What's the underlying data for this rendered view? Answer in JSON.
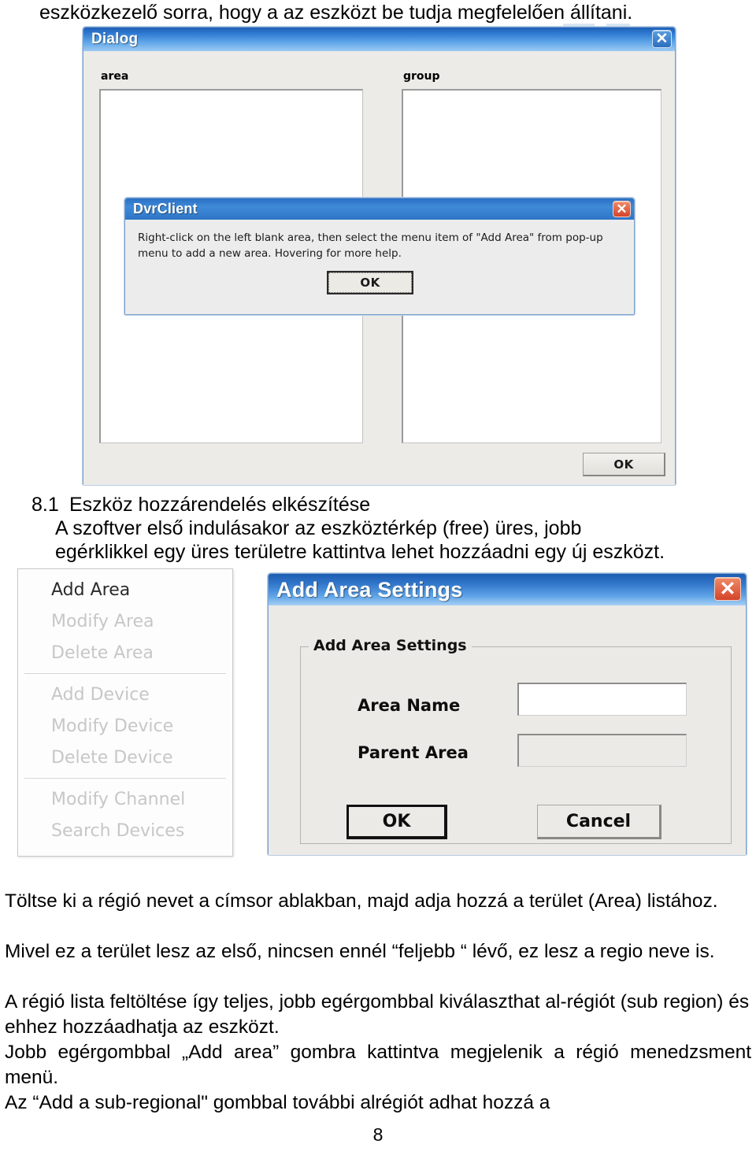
{
  "document": {
    "top_line": "eszközkezelő sorra, hogy a az eszközt be tudja megfelelően állítani.",
    "heading_number": "8.1",
    "heading_text": "Eszköz hozzárendelés elkészítése",
    "heading_sub_line1": "A szoftver első indulásakor az eszköztérkép (free) üres, jobb",
    "heading_sub_line2": "egérklikkel egy üres területre kattintva lehet hozzáadni egy új eszközt.",
    "paragraphs": [
      "Töltse ki a régió nevet a címsor ablakban, majd adja hozzá a terület (Area) listához.",
      "Mivel ez a terület lesz az első, nincsen ennél “feljebb “ lévő, ez lesz a regio neve is.",
      "A régió lista feltöltése így teljes, jobb egérgombbal kiválaszthat al-régiót (sub region) és ehhez hozzáadhatja az eszközt.",
      "Jobb egérgombbal „Add area” gombra kattintva megjelenik a régió menedzsment menü.",
      "Az “Add a sub-regional\" gombbal további alrégiót adhat hozzá a"
    ],
    "page_number": "8"
  },
  "dialog_main": {
    "title": "Dialog",
    "close_icon": "close-icon",
    "label_area": "area",
    "label_group": "group",
    "ok_label": "OK"
  },
  "dialog_dvrclient": {
    "title": "DvrClient",
    "close_icon": "close-icon",
    "message": "Right-click on the left blank area, then select the menu item of  \"Add Area\" from pop-up menu to add a new area. Hovering for more help.",
    "ok_label": "OK"
  },
  "context_menu": {
    "items": [
      {
        "label": "Add Area",
        "enabled": true
      },
      {
        "label": "Modify Area",
        "enabled": false
      },
      {
        "label": "Delete Area",
        "enabled": false
      },
      {
        "label": "Add Device",
        "enabled": false
      },
      {
        "label": "Modify Device",
        "enabled": false
      },
      {
        "label": "Delete Device",
        "enabled": false
      },
      {
        "label": "Modify Channel",
        "enabled": false
      },
      {
        "label": "Search Devices",
        "enabled": false
      }
    ]
  },
  "dialog_add_area": {
    "title": "Add Area Settings",
    "close_icon": "close-icon",
    "group_title": "Add Area Settings",
    "label_area_name": "Area Name",
    "label_parent_area": "Parent Area",
    "area_name_value": "",
    "parent_area_value": "",
    "ok_label": "OK",
    "cancel_label": "Cancel"
  },
  "colors": {
    "title_bar_blue": "#2f7ad2",
    "close_red": "#d4452a",
    "dialog_face": "#eceae5",
    "disabled_text": "#c7c7c7"
  }
}
